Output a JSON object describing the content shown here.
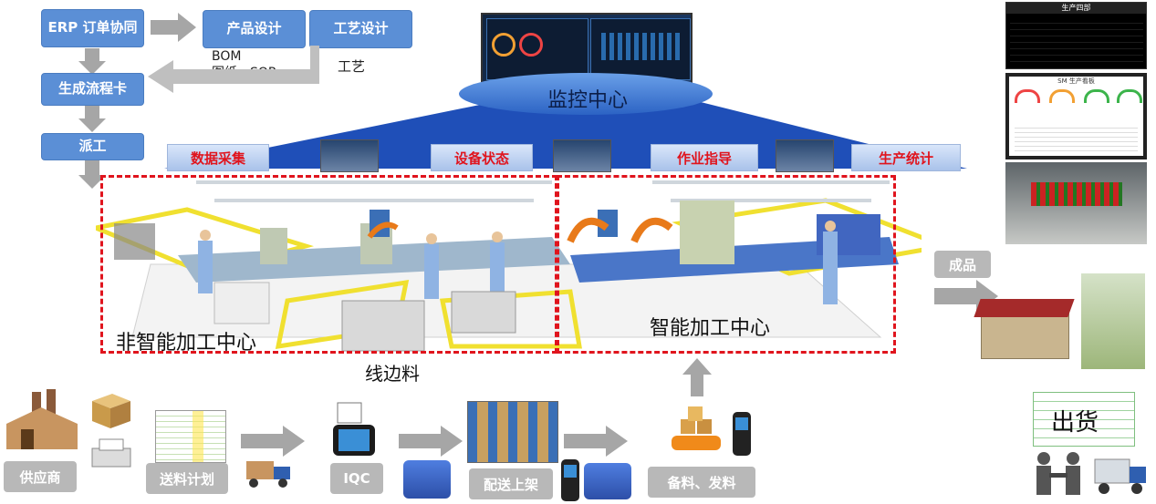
{
  "flow_top": {
    "erp": "ERP 订单协同",
    "product_design": "产品设计",
    "process_design": "工艺设计",
    "bom_note": "BOM\n图纸、SOP",
    "process_note": "工艺",
    "flow_card": "生成流程卡",
    "dispatch": "派工"
  },
  "monitor": {
    "title": "监控中心"
  },
  "tags": {
    "data_collection": "数据采集",
    "device_status": "设备状态",
    "work_guide": "作业指导",
    "production_stats": "生产统计"
  },
  "zones": {
    "non_smart": "非智能加工中心",
    "smart": "智能加工中心",
    "line_side": "线边料"
  },
  "right": {
    "finished": "成品",
    "shipping": "出货",
    "board_title": "生产四部",
    "board2_title": "SM 生产看板"
  },
  "bottom": {
    "supplier": "供应商",
    "delivery_plan": "送料计划",
    "iqc": "IQC",
    "shelving": "配送上架",
    "picking": "备料、发料"
  },
  "colors": {
    "blue_box": "#5b8fd6",
    "gray_box": "#b8b8b8",
    "dashed_red": "#e0141d",
    "tag_text": "#e0141d"
  }
}
